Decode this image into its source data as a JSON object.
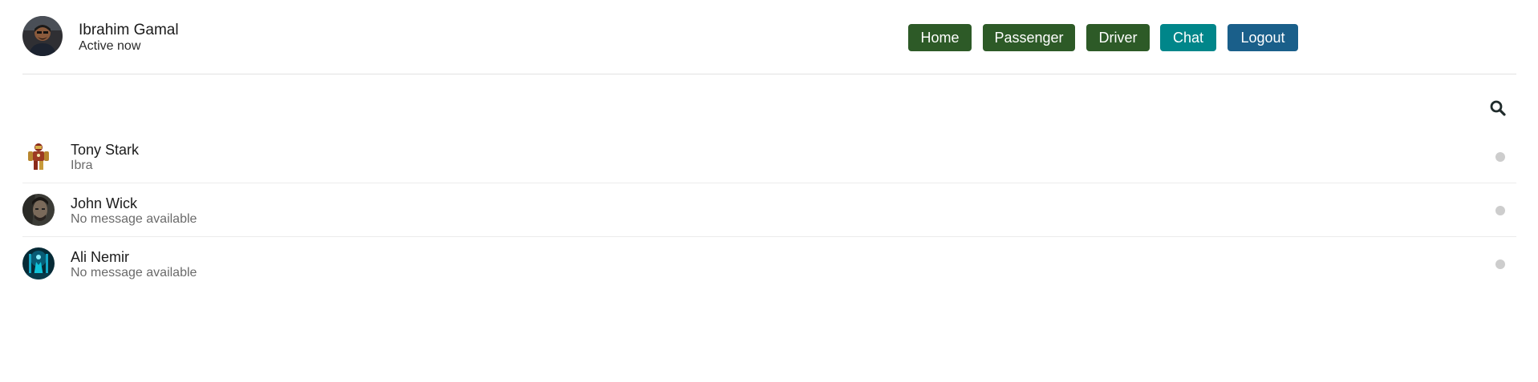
{
  "user": {
    "name": "Ibrahim Gamal",
    "status": "Active now"
  },
  "nav": {
    "home": "Home",
    "passenger": "Passenger",
    "driver": "Driver",
    "chat": "Chat",
    "logout": "Logout"
  },
  "colors": {
    "nav_green": "#2d5a27",
    "nav_teal": "#00868a",
    "nav_blue": "#1a5f8a",
    "status_dot": "#cdcdcd"
  },
  "search": {
    "icon": "search-icon"
  },
  "chats": [
    {
      "name": "Tony Stark",
      "message": "Ibra"
    },
    {
      "name": "John Wick",
      "message": "No message available"
    },
    {
      "name": "Ali Nemir",
      "message": "No message available"
    }
  ]
}
